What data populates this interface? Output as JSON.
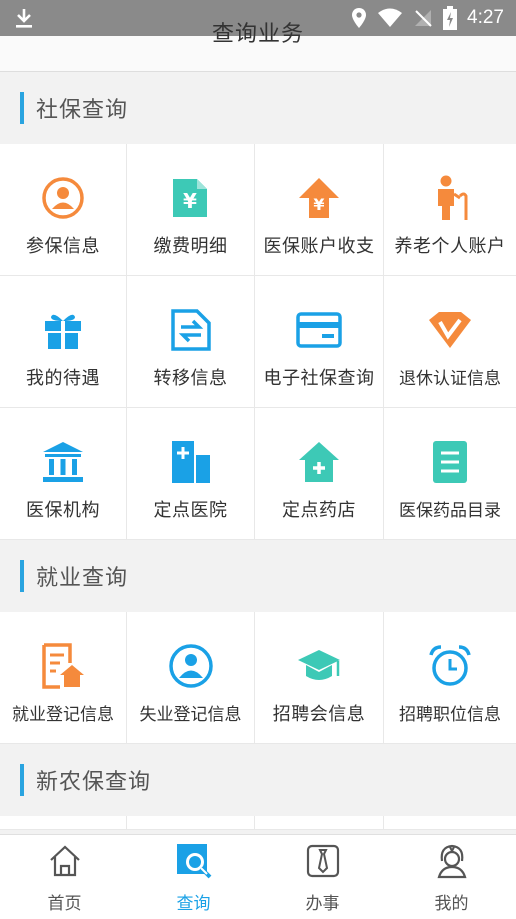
{
  "status_bar": {
    "time": "4:27"
  },
  "header": {
    "title": "查询业务"
  },
  "sections": [
    {
      "title": "社保查询",
      "items": [
        {
          "label": "参保信息",
          "icon": "person-circle-icon"
        },
        {
          "label": "缴费明细",
          "icon": "yuan-document-icon"
        },
        {
          "label": "医保账户收支",
          "icon": "yuan-arrow-icon"
        },
        {
          "label": "养老个人账户",
          "icon": "elderly-person-icon"
        },
        {
          "label": "我的待遇",
          "icon": "gift-icon"
        },
        {
          "label": "转移信息",
          "icon": "transfer-document-icon"
        },
        {
          "label": "电子社保查询",
          "icon": "card-icon"
        },
        {
          "label": "退休认证信息",
          "icon": "badge-v-icon"
        },
        {
          "label": "医保机构",
          "icon": "institution-icon"
        },
        {
          "label": "定点医院",
          "icon": "hospital-icon"
        },
        {
          "label": "定点药店",
          "icon": "pharmacy-icon"
        },
        {
          "label": "医保药品目录",
          "icon": "list-document-icon"
        }
      ]
    },
    {
      "title": "就业查询",
      "items": [
        {
          "label": "就业登记信息",
          "icon": "register-home-icon"
        },
        {
          "label": "失业登记信息",
          "icon": "person-badge-icon"
        },
        {
          "label": "招聘会信息",
          "icon": "graduation-cap-icon"
        },
        {
          "label": "招聘职位信息",
          "icon": "alarm-clock-icon"
        }
      ]
    },
    {
      "title": "新农保查询",
      "items": []
    }
  ],
  "tabs": [
    {
      "label": "首页",
      "icon": "home-icon"
    },
    {
      "label": "查询",
      "icon": "search-icon"
    },
    {
      "label": "办事",
      "icon": "tie-icon"
    },
    {
      "label": "我的",
      "icon": "user-icon"
    }
  ],
  "colors": {
    "accent": "#1aa1e6",
    "section_bar": "#2aa4e0",
    "orange": "#f58a3c",
    "teal": "#3dc9b6",
    "blue": "#1aa1e6"
  }
}
